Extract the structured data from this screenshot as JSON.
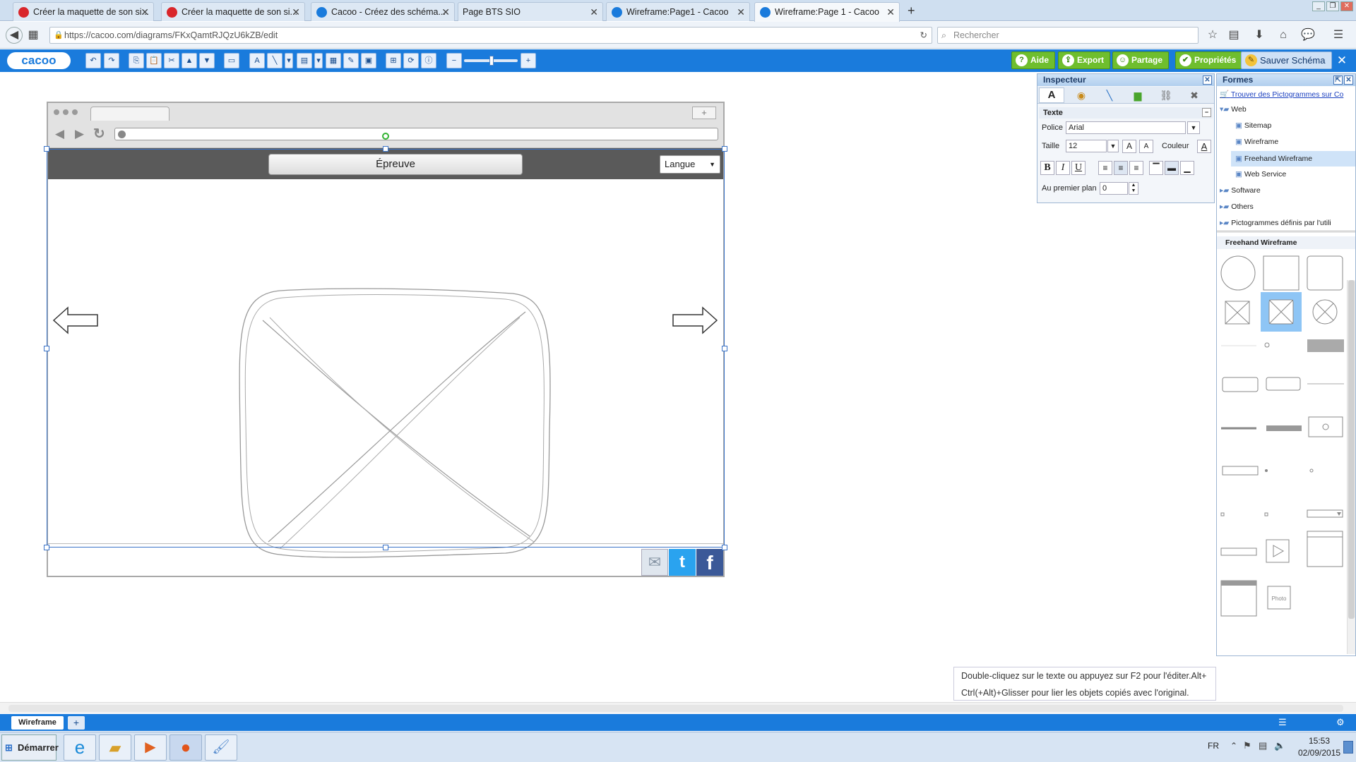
{
  "tabs": [
    {
      "label": "Créer la maquette de son si...",
      "icon": "help-icon",
      "active": false
    },
    {
      "label": "Créer la maquette de son si...",
      "icon": "help-icon",
      "active": false
    },
    {
      "label": "Cacoo - Créez des schéma...",
      "icon": "cacoo-icon",
      "active": false
    },
    {
      "label": "Page BTS SIO",
      "icon": "",
      "active": false
    },
    {
      "label": "Wireframe:Page1 - Cacoo",
      "icon": "cacoo-icon",
      "active": false
    },
    {
      "label": "Wireframe:Page 1 - Cacoo",
      "icon": "cacoo-icon",
      "active": true
    }
  ],
  "address": {
    "url": "https://cacoo.com/diagrams/FKxQamtRJQzU6kZB/edit",
    "search_placeholder": "Rechercher"
  },
  "toolbar": {
    "logo": "cacoo",
    "right_buttons": [
      {
        "label": "Aide",
        "icon": "help-icon"
      },
      {
        "label": "Export",
        "icon": "export-icon"
      },
      {
        "label": "Partage",
        "icon": "share-icon"
      },
      {
        "label": "Propriétés",
        "icon": "properties-icon"
      },
      {
        "label": "Sauver Schéma",
        "icon": "save-icon"
      }
    ],
    "accent": "#1a7bdc",
    "green": "#6fbe2e"
  },
  "wireframe": {
    "header_button": "Épreuve",
    "dropdown": "Langue",
    "header_bg": "#5a5a5a"
  },
  "inspector": {
    "title": "Inspecteur",
    "section": "Texte",
    "police_label": "Police",
    "police_value": "Arial",
    "taille_label": "Taille",
    "taille_value": "12",
    "couleur_label": "Couleur",
    "foreground_label": "Au premier plan",
    "foreground_value": "0",
    "format_buttons": [
      "B",
      "I",
      "U"
    ]
  },
  "shapes_panel": {
    "title": "Formes",
    "find_link": "Trouver des Pictogrammes sur Co",
    "tree": [
      {
        "label": "Web",
        "level": 0
      },
      {
        "label": "Sitemap",
        "level": 1
      },
      {
        "label": "Wireframe",
        "level": 1
      },
      {
        "label": "Freehand Wireframe",
        "level": 1,
        "selected": true
      },
      {
        "label": "Web Service",
        "level": 1
      },
      {
        "label": "Software",
        "level": 0
      },
      {
        "label": "Others",
        "level": 0
      },
      {
        "label": "Pictogrammes définis par l'utili",
        "level": 0
      }
    ],
    "section_title": "Freehand Wireframe",
    "photo_label": "Photo"
  },
  "hint": {
    "line1": "Double-cliquez sur le texte ou appuyez sur F2 pour l'éditer.Alt+",
    "line2": "Ctrl(+Alt)+Glisser pour lier les objets copiés avec l'original."
  },
  "page_tabs": [
    {
      "label": "Wireframe"
    }
  ],
  "taskbar": {
    "start": "Démarrer",
    "lang": "FR",
    "time": "15:53",
    "date": "02/09/2015"
  }
}
